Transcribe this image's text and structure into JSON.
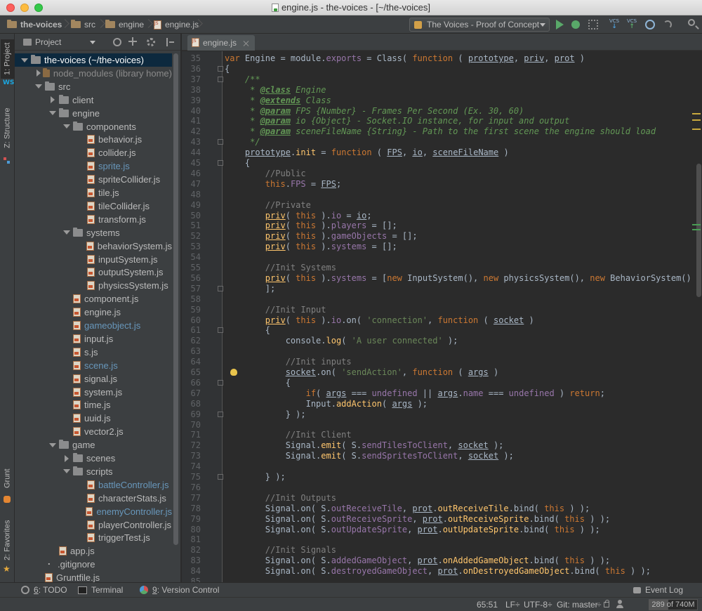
{
  "window": {
    "title": "engine.js - the-voices - [~/the-voices]"
  },
  "navbar": {
    "breadcrumbs": [
      "the-voices",
      "src",
      "engine",
      "engine.js"
    ],
    "run_config": "The Voices - Proof of Concept"
  },
  "left_strip": {
    "project_tab": "1: Project",
    "structure_tab": "Z: Structure",
    "grunt_tab": "Grunt",
    "favorites_tab": "2: Favorites"
  },
  "project_panel": {
    "title": "Project",
    "tree": [
      {
        "label": "the-voices (~/the-voices)",
        "kind": "folder",
        "state": "open",
        "depth": 0,
        "selected": true
      },
      {
        "label": "node_modules (library home)",
        "kind": "folder-mod",
        "state": "closed",
        "depth": 1,
        "style": "lib"
      },
      {
        "label": "src",
        "kind": "folder",
        "state": "open",
        "depth": 1
      },
      {
        "label": "client",
        "kind": "folder",
        "state": "closed",
        "depth": 2
      },
      {
        "label": "engine",
        "kind": "folder",
        "state": "open",
        "depth": 2
      },
      {
        "label": "components",
        "kind": "folder",
        "state": "open",
        "depth": 3
      },
      {
        "label": "behavior.js",
        "kind": "js",
        "depth": 4
      },
      {
        "label": "collider.js",
        "kind": "js",
        "depth": 4
      },
      {
        "label": "sprite.js",
        "kind": "js",
        "depth": 4,
        "style": "mod"
      },
      {
        "label": "spriteCollider.js",
        "kind": "js",
        "depth": 4
      },
      {
        "label": "tile.js",
        "kind": "js",
        "depth": 4
      },
      {
        "label": "tileCollider.js",
        "kind": "js",
        "depth": 4
      },
      {
        "label": "transform.js",
        "kind": "js",
        "depth": 4
      },
      {
        "label": "systems",
        "kind": "folder",
        "state": "open",
        "depth": 3
      },
      {
        "label": "behaviorSystem.js",
        "kind": "js",
        "depth": 4
      },
      {
        "label": "inputSystem.js",
        "kind": "js",
        "depth": 4
      },
      {
        "label": "outputSystem.js",
        "kind": "js",
        "depth": 4
      },
      {
        "label": "physicsSystem.js",
        "kind": "js",
        "depth": 4
      },
      {
        "label": "component.js",
        "kind": "js",
        "depth": 3
      },
      {
        "label": "engine.js",
        "kind": "js",
        "depth": 3
      },
      {
        "label": "gameobject.js",
        "kind": "js",
        "depth": 3,
        "style": "mod"
      },
      {
        "label": "input.js",
        "kind": "js",
        "depth": 3
      },
      {
        "label": "s.js",
        "kind": "js",
        "depth": 3
      },
      {
        "label": "scene.js",
        "kind": "js",
        "depth": 3,
        "style": "mod"
      },
      {
        "label": "signal.js",
        "kind": "js",
        "depth": 3
      },
      {
        "label": "system.js",
        "kind": "js",
        "depth": 3
      },
      {
        "label": "time.js",
        "kind": "js",
        "depth": 3
      },
      {
        "label": "uuid.js",
        "kind": "js",
        "depth": 3
      },
      {
        "label": "vector2.js",
        "kind": "js",
        "depth": 3
      },
      {
        "label": "game",
        "kind": "folder",
        "state": "open",
        "depth": 2
      },
      {
        "label": "scenes",
        "kind": "folder",
        "state": "closed",
        "depth": 3
      },
      {
        "label": "scripts",
        "kind": "folder",
        "state": "open",
        "depth": 3
      },
      {
        "label": "battleController.js",
        "kind": "js",
        "depth": 4,
        "style": "mod"
      },
      {
        "label": "characterStats.js",
        "kind": "js",
        "depth": 4
      },
      {
        "label": "enemyController.js",
        "kind": "js",
        "depth": 4,
        "style": "mod"
      },
      {
        "label": "playerController.js",
        "kind": "js",
        "depth": 4
      },
      {
        "label": "triggerTest.js",
        "kind": "js",
        "depth": 4
      },
      {
        "label": "app.js",
        "kind": "js",
        "depth": 2
      },
      {
        "label": ".gitignore",
        "kind": "git",
        "depth": 1
      },
      {
        "label": "Gruntfile.js",
        "kind": "js",
        "depth": 1
      }
    ]
  },
  "editor": {
    "tab_label": "engine.js",
    "first_line": 35,
    "bulb_line": 65,
    "fold_lines": [
      36,
      37,
      43,
      45,
      57,
      61,
      66,
      69,
      75
    ],
    "lines": [
      [
        [
          "kw",
          "var "
        ],
        [
          "plain",
          "Engine = module."
        ],
        [
          "prop",
          "exports"
        ],
        [
          "plain",
          " = Class( "
        ],
        [
          "kw",
          "function "
        ],
        [
          "plain",
          "( "
        ],
        [
          "plain ul",
          "prototype"
        ],
        [
          "plain",
          ", "
        ],
        [
          "plain ul",
          "priv"
        ],
        [
          "plain",
          ", "
        ],
        [
          "plain ul",
          "prot"
        ],
        [
          "plain",
          " )"
        ]
      ],
      [
        [
          "plain",
          "{"
        ]
      ],
      [
        [
          "doc",
          "    /**"
        ]
      ],
      [
        [
          "doc",
          "     * "
        ],
        [
          "tag",
          "@class"
        ],
        [
          "doc",
          " Engine"
        ]
      ],
      [
        [
          "doc",
          "     * "
        ],
        [
          "tag",
          "@extends"
        ],
        [
          "doc",
          " Class"
        ]
      ],
      [
        [
          "doc",
          "     * "
        ],
        [
          "tag",
          "@param"
        ],
        [
          "doc",
          " FPS {Number} - Frames Per Second (Ex. 30, 60)"
        ]
      ],
      [
        [
          "doc",
          "     * "
        ],
        [
          "tag",
          "@param"
        ],
        [
          "doc",
          " io {Object} - Socket.IO instance, for input and output"
        ]
      ],
      [
        [
          "doc",
          "     * "
        ],
        [
          "tag",
          "@param"
        ],
        [
          "doc",
          " sceneFileName {String} - Path to the first scene the engine should load"
        ]
      ],
      [
        [
          "doc",
          "     */"
        ]
      ],
      [
        [
          "plain",
          "    "
        ],
        [
          "plain ul",
          "prototype"
        ],
        [
          "plain",
          "."
        ],
        [
          "fn",
          "init"
        ],
        [
          "plain",
          " = "
        ],
        [
          "kw",
          "function "
        ],
        [
          "plain",
          "( "
        ],
        [
          "plain ul",
          "FPS"
        ],
        [
          "plain",
          ", "
        ],
        [
          "plain ul",
          "io"
        ],
        [
          "plain",
          ", "
        ],
        [
          "plain ul",
          "sceneFileName"
        ],
        [
          "plain",
          " )"
        ]
      ],
      [
        [
          "plain",
          "    {"
        ]
      ],
      [
        [
          "cm",
          "        //Public"
        ]
      ],
      [
        [
          "plain",
          "        "
        ],
        [
          "th",
          "this"
        ],
        [
          "plain",
          "."
        ],
        [
          "prop",
          "FPS"
        ],
        [
          "plain",
          " = "
        ],
        [
          "plain ul",
          "FPS"
        ],
        [
          "plain",
          ";"
        ]
      ],
      [
        [
          "plain",
          ""
        ]
      ],
      [
        [
          "cm",
          "        //Private"
        ]
      ],
      [
        [
          "plain",
          "        "
        ],
        [
          "fn ul",
          "priv"
        ],
        [
          "plain",
          "( "
        ],
        [
          "th",
          "this"
        ],
        [
          "plain",
          " )."
        ],
        [
          "prop",
          "io"
        ],
        [
          "plain",
          " = "
        ],
        [
          "plain ul",
          "io"
        ],
        [
          "plain",
          ";"
        ]
      ],
      [
        [
          "plain",
          "        "
        ],
        [
          "fn ul",
          "priv"
        ],
        [
          "plain",
          "( "
        ],
        [
          "th",
          "this"
        ],
        [
          "plain",
          " )."
        ],
        [
          "prop",
          "players"
        ],
        [
          "plain",
          " = [];"
        ]
      ],
      [
        [
          "plain",
          "        "
        ],
        [
          "fn ul",
          "priv"
        ],
        [
          "plain",
          "( "
        ],
        [
          "th",
          "this"
        ],
        [
          "plain",
          " )."
        ],
        [
          "prop",
          "gameObjects"
        ],
        [
          "plain",
          " = [];"
        ]
      ],
      [
        [
          "plain",
          "        "
        ],
        [
          "fn ul",
          "priv"
        ],
        [
          "plain",
          "( "
        ],
        [
          "th",
          "this"
        ],
        [
          "plain",
          " )."
        ],
        [
          "prop",
          "systems"
        ],
        [
          "plain",
          " = [];"
        ]
      ],
      [
        [
          "plain",
          ""
        ]
      ],
      [
        [
          "cm",
          "        //Init Systems"
        ]
      ],
      [
        [
          "plain",
          "        "
        ],
        [
          "fn ul",
          "priv"
        ],
        [
          "plain",
          "( "
        ],
        [
          "th",
          "this"
        ],
        [
          "plain",
          " )."
        ],
        [
          "prop",
          "systems"
        ],
        [
          "plain",
          " = ["
        ],
        [
          "kw",
          "new "
        ],
        [
          "plain",
          "InputSystem(), "
        ],
        [
          "kw",
          "new "
        ],
        [
          "plain",
          "physicsSystem(), "
        ],
        [
          "kw",
          "new "
        ],
        [
          "plain",
          "BehaviorSystem()"
        ]
      ],
      [
        [
          "plain",
          "        ];"
        ]
      ],
      [
        [
          "plain",
          ""
        ]
      ],
      [
        [
          "cm",
          "        //Init Input"
        ]
      ],
      [
        [
          "plain",
          "        "
        ],
        [
          "fn ul",
          "priv"
        ],
        [
          "plain",
          "( "
        ],
        [
          "th",
          "this"
        ],
        [
          "plain",
          " )."
        ],
        [
          "prop",
          "io"
        ],
        [
          "plain",
          ".on( "
        ],
        [
          "str",
          "'connection'"
        ],
        [
          "plain",
          ", "
        ],
        [
          "kw",
          "function "
        ],
        [
          "plain",
          "( "
        ],
        [
          "plain ul",
          "socket"
        ],
        [
          "plain",
          " )"
        ]
      ],
      [
        [
          "plain",
          "        {"
        ]
      ],
      [
        [
          "plain",
          "            console."
        ],
        [
          "fn",
          "log"
        ],
        [
          "plain",
          "( "
        ],
        [
          "str",
          "'A user connected'"
        ],
        [
          "plain",
          " );"
        ]
      ],
      [
        [
          "plain",
          ""
        ]
      ],
      [
        [
          "cm",
          "            //Init inputs"
        ]
      ],
      [
        [
          "plain",
          "            "
        ],
        [
          "plain ul",
          "socket"
        ],
        [
          "plain",
          ".on( "
        ],
        [
          "str",
          "'sendAction'"
        ],
        [
          "plain",
          ", "
        ],
        [
          "kw",
          "function "
        ],
        [
          "plain",
          "( "
        ],
        [
          "plain ul",
          "args"
        ],
        [
          "plain",
          " )"
        ]
      ],
      [
        [
          "plain",
          "            {"
        ]
      ],
      [
        [
          "plain",
          "                "
        ],
        [
          "kw",
          "if"
        ],
        [
          "plain",
          "( "
        ],
        [
          "plain ul",
          "args"
        ],
        [
          "plain",
          " === "
        ],
        [
          "prop",
          "undefined"
        ],
        [
          "plain",
          " || "
        ],
        [
          "plain ul",
          "args"
        ],
        [
          "plain",
          "."
        ],
        [
          "prop",
          "name"
        ],
        [
          "plain",
          " === "
        ],
        [
          "prop",
          "undefined"
        ],
        [
          "plain",
          " ) "
        ],
        [
          "kw",
          "return"
        ],
        [
          "plain",
          ";"
        ]
      ],
      [
        [
          "plain",
          "                Input."
        ],
        [
          "fn",
          "addAction"
        ],
        [
          "plain",
          "( "
        ],
        [
          "plain ul",
          "args"
        ],
        [
          "plain",
          " );"
        ]
      ],
      [
        [
          "plain",
          "            } );"
        ]
      ],
      [
        [
          "plain",
          ""
        ]
      ],
      [
        [
          "cm",
          "            //Init Client"
        ]
      ],
      [
        [
          "plain",
          "            Signal."
        ],
        [
          "fn",
          "emit"
        ],
        [
          "plain",
          "( S."
        ],
        [
          "prop",
          "sendTilesToClient"
        ],
        [
          "plain",
          ", "
        ],
        [
          "plain ul",
          "socket"
        ],
        [
          "plain",
          " );"
        ]
      ],
      [
        [
          "plain",
          "            Signal."
        ],
        [
          "fn",
          "emit"
        ],
        [
          "plain",
          "( S."
        ],
        [
          "prop",
          "sendSpritesToClient"
        ],
        [
          "plain",
          ", "
        ],
        [
          "plain ul",
          "socket"
        ],
        [
          "plain",
          " );"
        ]
      ],
      [
        [
          "plain",
          ""
        ]
      ],
      [
        [
          "plain",
          "        } );"
        ]
      ],
      [
        [
          "plain",
          ""
        ]
      ],
      [
        [
          "cm",
          "        //Init Outputs"
        ]
      ],
      [
        [
          "plain",
          "        Signal.on( S."
        ],
        [
          "prop",
          "outReceiveTile"
        ],
        [
          "plain",
          ", "
        ],
        [
          "plain ul",
          "prot"
        ],
        [
          "plain",
          "."
        ],
        [
          "fn",
          "outReceiveTile"
        ],
        [
          "plain",
          ".bind( "
        ],
        [
          "th",
          "this"
        ],
        [
          "plain",
          " ) );"
        ]
      ],
      [
        [
          "plain",
          "        Signal.on( S."
        ],
        [
          "prop",
          "outReceiveSprite"
        ],
        [
          "plain",
          ", "
        ],
        [
          "plain ul",
          "prot"
        ],
        [
          "plain",
          "."
        ],
        [
          "fn",
          "outReceiveSprite"
        ],
        [
          "plain",
          ".bind( "
        ],
        [
          "th",
          "this"
        ],
        [
          "plain",
          " ) );"
        ]
      ],
      [
        [
          "plain",
          "        Signal.on( S."
        ],
        [
          "prop",
          "outUpdateSprite"
        ],
        [
          "plain",
          ", "
        ],
        [
          "plain ul",
          "prot"
        ],
        [
          "plain",
          "."
        ],
        [
          "fn",
          "outUpdateSprite"
        ],
        [
          "plain",
          ".bind( "
        ],
        [
          "th",
          "this"
        ],
        [
          "plain",
          " ) );"
        ]
      ],
      [
        [
          "plain",
          ""
        ]
      ],
      [
        [
          "cm",
          "        //Init Signals"
        ]
      ],
      [
        [
          "plain",
          "        Signal.on( S."
        ],
        [
          "prop",
          "addedGameObject"
        ],
        [
          "plain",
          ", "
        ],
        [
          "plain ul",
          "prot"
        ],
        [
          "plain",
          "."
        ],
        [
          "fn",
          "onAddedGameObject"
        ],
        [
          "plain",
          ".bind( "
        ],
        [
          "th",
          "this"
        ],
        [
          "plain",
          " ) );"
        ]
      ],
      [
        [
          "plain",
          "        Signal.on( S."
        ],
        [
          "prop",
          "destroyedGameObject"
        ],
        [
          "plain",
          ", "
        ],
        [
          "plain ul",
          "prot"
        ],
        [
          "plain",
          "."
        ],
        [
          "fn",
          "onDestroyedGameObject"
        ],
        [
          "plain",
          ".bind( "
        ],
        [
          "th",
          "this"
        ],
        [
          "plain",
          " ) );"
        ]
      ],
      [
        [
          "plain",
          ""
        ]
      ]
    ]
  },
  "bottom_tabs": {
    "todo_num": "6",
    "todo_label": ": TODO",
    "terminal": "Terminal",
    "vc_num": "9",
    "vc_label": ": Version Control",
    "event_log": "Event Log"
  },
  "status": {
    "position": "65:51",
    "line_sep": "LF÷",
    "encoding": "UTF-8÷",
    "git": "Git: master",
    "git_arrow": "÷",
    "memory": "289 of 740M",
    "memory_fraction": 0.39
  },
  "colors": {
    "keyword": "#cc7832",
    "function": "#ffc66d",
    "string": "#6a8759",
    "comment": "#808080",
    "doc": "#629755",
    "property": "#9876aa",
    "default": "#a9b7c6",
    "modified_file": "#6897bb"
  }
}
